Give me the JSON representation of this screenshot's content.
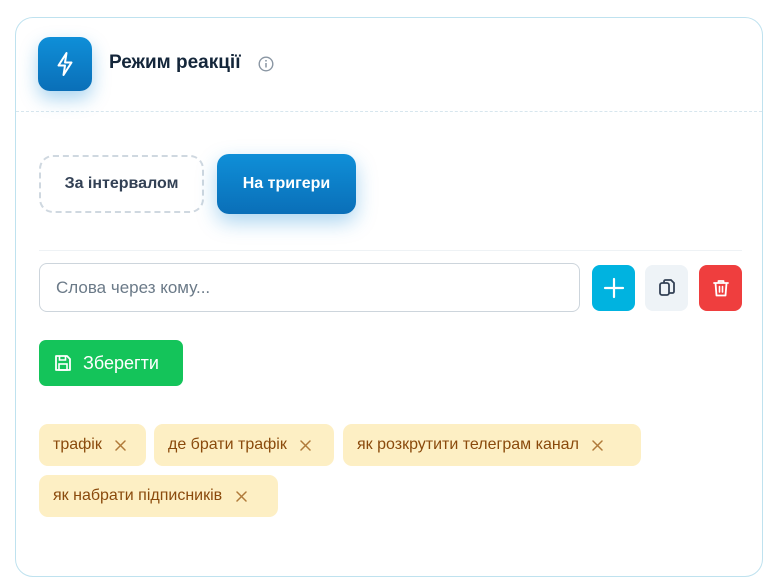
{
  "section": {
    "title": "Режим реакції",
    "icon": "lightning-bolt-icon",
    "info_icon": "info-icon"
  },
  "modes": {
    "interval_label": "За інтервалом",
    "triggers_label": "На тригери",
    "selected": "На тригери"
  },
  "keywords_input": {
    "placeholder": "Слова через кому...",
    "value": ""
  },
  "actions": {
    "add_icon": "plus-icon",
    "copy_icon": "copy-icon",
    "delete_icon": "trash-icon",
    "save_label": "Зберегти",
    "save_icon": "floppy-disk-icon"
  },
  "tags": [
    "трафік",
    "де брати трафік",
    "як розкрутити телеграм канал",
    "як набрати підписників"
  ],
  "colors": {
    "accent": "#0a7fca",
    "add_button": "#00b3e0",
    "delete_button": "#ef3e3e",
    "save_button": "#14c45a",
    "tag_background": "#fdefc4",
    "tag_text": "#8a4a0c"
  }
}
